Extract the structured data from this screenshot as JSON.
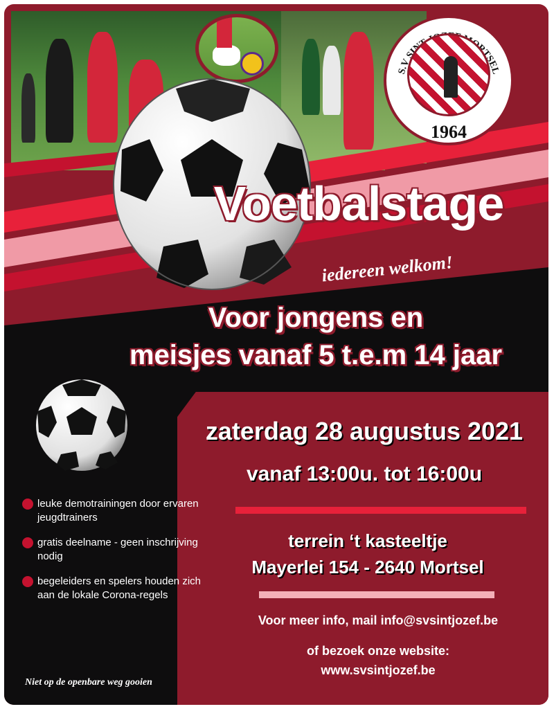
{
  "colors": {
    "brand_red": "#8e1b2c",
    "accent_red": "#c4122f",
    "bright_red": "#e8213a",
    "pink": "#f4b0b8",
    "black": "#0e0d0e"
  },
  "logo": {
    "ring_text": "S.V SINT-JOZEF MORTSEL",
    "year": "1964",
    "icon": "club-crest-icon"
  },
  "headline": {
    "title": "Voetbalstage",
    "welcome": "iedereen welkom!",
    "target_line1": "Voor jongens en",
    "target_line2": "meisjes vanaf 5 t.e.m 14 jaar"
  },
  "event": {
    "date": "zaterdag 28 augustus 2021",
    "time": "vanaf 13:00u. tot 16:00u",
    "venue_line1": "terrein ‘t kasteeltje",
    "venue_line2": "Mayerlei 154 - 2640 Mortsel"
  },
  "contact": {
    "mail_line": "Voor meer info, mail info@svsintjozef.be",
    "website_intro": "of bezoek onze website:",
    "website": "www.svsintjozef.be"
  },
  "bullets": [
    {
      "text": "leuke demotrainingen door ervaren jeugdtrainers"
    },
    {
      "text": "gratis deelname - geen inschrijving nodig"
    },
    {
      "text": "begeleiders en spelers houden zich aan de lokale Corona-regels"
    }
  ],
  "footer": {
    "note": "Niet op de openbare weg gooien"
  }
}
